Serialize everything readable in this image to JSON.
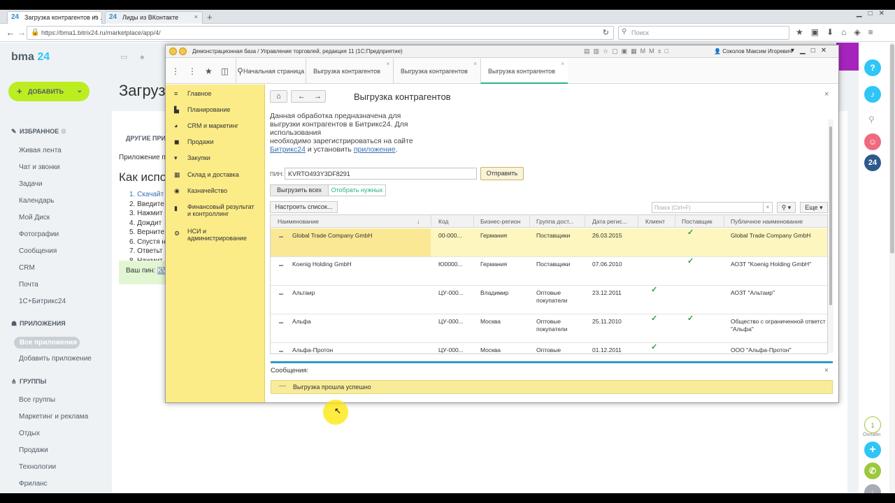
{
  "browser": {
    "tabs": [
      {
        "fav": "24",
        "label": "Загрузка контрагентов из ..."
      },
      {
        "fav": "24",
        "label": "Лиды из ВКонтакте"
      }
    ],
    "url": "https://bma1.bitrix24.ru/marketplace/app/4/",
    "search_placeholder": "Поиск"
  },
  "bitrix": {
    "logo_text": "bma",
    "logo_num": "24",
    "add_button": "ДОБАВИТЬ",
    "favorites_head": "ИЗБРАННОЕ",
    "favorites": [
      "Живая лента",
      "Чат и звонки",
      "Задачи",
      "Календарь",
      "Мой Диск",
      "Фотографии",
      "Сообщения",
      "CRM",
      "Почта",
      "1С+Битрикс24"
    ],
    "apps_head": "ПРИЛОЖЕНИЯ",
    "all_apps": "Все приложения",
    "add_app": "Добавить приложение",
    "groups_head": "ГРУППЫ",
    "groups": [
      "Все группы",
      "Маркетинг и реклама",
      "Отдых",
      "Продажи",
      "Технологии",
      "Фриланс"
    ],
    "page_title": "Загруз",
    "other_tab": "ДРУГИЕ ПРИ",
    "app_text": "Приложение по",
    "howto_title": "Как испол",
    "steps": [
      "1. Скачайт",
      "2. Введите",
      "3. Нажмит",
      "4. Дождит",
      "5. Верните",
      "6. Спустя н",
      "7. Ответьт",
      "8. Нажмит"
    ],
    "pin_label": "Ваш пин:",
    "pin_tail": "KV",
    "online_count": "1",
    "online_label": "Онлайн"
  },
  "onec": {
    "title": "Демонстрационная база / Управление торговлей, редакция 11  (1С:Предприятие)",
    "user": "Соколов Максим Игоревич",
    "tabs": [
      "Начальная страница",
      "Выгрузка контрагентов",
      "Выгрузка контрагентов",
      "Выгрузка контрагентов"
    ],
    "sidebar": [
      "Главное",
      "Планирование",
      "CRM и маркетинг",
      "Продажи",
      "Закупки",
      "Склад и доставка",
      "Казначейство",
      "Финансовый результат и контроллинг",
      "НСИ и администрирование"
    ],
    "form_title": "Выгрузка контрагентов",
    "desc_1": "Данная обработка предназначена для выгрузки контрагентов в Битрикс24. Для использования",
    "desc_2": "необходимо зарегистрироваться на сайте",
    "desc_link1": "Битрикс24",
    "desc_mid": " и установить ",
    "desc_link2": "приложение",
    "desc_end": ".",
    "pin_label": "ПИН:",
    "pin_value": "KVRTO493Y3DF8291",
    "send_button": "Отправить",
    "btn_all": "Выгрузить всех",
    "btn_need": "Отобрать нужных",
    "btn_config": "Настроить список...",
    "search_placeholder": "Поиск (Ctrl+F)",
    "more_button": "Еще",
    "columns": [
      "Наименование",
      "Код",
      "Бизнес-регион",
      "Группа дост...",
      "Дата регис...",
      "Клиент",
      "Поставщик",
      "Публичное наименование"
    ],
    "rows": [
      {
        "name": "Global Trade Company GmbH",
        "code": "00-000...",
        "region": "Германия",
        "group": "Поставщики",
        "date": "26.03.2015",
        "client": "",
        "supplier": "✓",
        "public": "Global Trade Company GmbH"
      },
      {
        "name": "Koenig Holding GmbH",
        "code": "Ю0000...",
        "region": "Германия",
        "group": "Поставщики",
        "date": "07.06.2010",
        "client": "",
        "supplier": "✓",
        "public": "АОЗТ \"Koenig Holding GmbH\""
      },
      {
        "name": "Альтаир",
        "code": "ЦУ-000...",
        "region": "Владимир",
        "group": "Оптовые покупатели",
        "date": "23.12.2011",
        "client": "✓",
        "supplier": "",
        "public": "АОЗТ \"Альтаир\""
      },
      {
        "name": "Альфа",
        "code": "ЦУ-000...",
        "region": "Москва",
        "group": "Оптовые покупатели",
        "date": "25.11.2010",
        "client": "✓",
        "supplier": "✓",
        "public": "Общество с ограниченной ответст \"Альфа\""
      },
      {
        "name": "Альфа-Протон",
        "code": "ЦУ-000...",
        "region": "Москва",
        "group": "Оптовые",
        "date": "01.12.2011",
        "client": "✓",
        "supplier": "",
        "public": "ООО \"Альфа-Протон\""
      }
    ],
    "messages_title": "Сообщения:",
    "message": "Выгрузка прошла успешно"
  }
}
